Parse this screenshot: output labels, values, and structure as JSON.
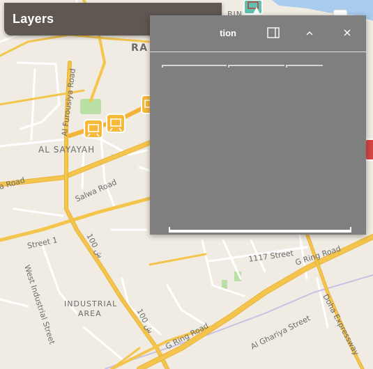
{
  "layers_panel": {
    "title": "Layers",
    "toggle_icon": "chevron-down-icon"
  },
  "info_window": {
    "title": "tion",
    "buttons": [
      {
        "name": "dock-icon"
      },
      {
        "name": "collapse-icon"
      },
      {
        "name": "close-icon"
      }
    ],
    "tabs": [
      {},
      {},
      {}
    ]
  },
  "map": {
    "labels": {
      "area_top": "RA",
      "area_top_right": "BIN",
      "al_sayayah": "AL SAYAYAH",
      "al_furousiya_road": "Al Furousiya Road",
      "salwa_road": "Salwa Road",
      "a_road_left": "a Road",
      "street_1": "Street 1",
      "west_industrial_street": "West Industrial Street",
      "industrial_area_1": "INDUSTRIAL",
      "industrial_area_2": "AREA",
      "road_100_top": "100 ش",
      "road_100_bottom": "100 ش",
      "street_1117": "1117 Street",
      "g_ring_road_right": "G Ring Road",
      "g_ring_road_bottom": "G Ring Road",
      "al_ghariya_street": "Al Ghariya Street",
      "doha_expressway": "Doha Expressway"
    },
    "colors": {
      "land": "#f1ece3",
      "major_road": "#f4c54c",
      "major_road_casing": "#e8b33a",
      "minor_road": "#ffffff",
      "metro_line": "#f3b23a",
      "park": "#b9dfa5",
      "water": "#a9cdee",
      "rail": "#c9c0e6"
    }
  }
}
